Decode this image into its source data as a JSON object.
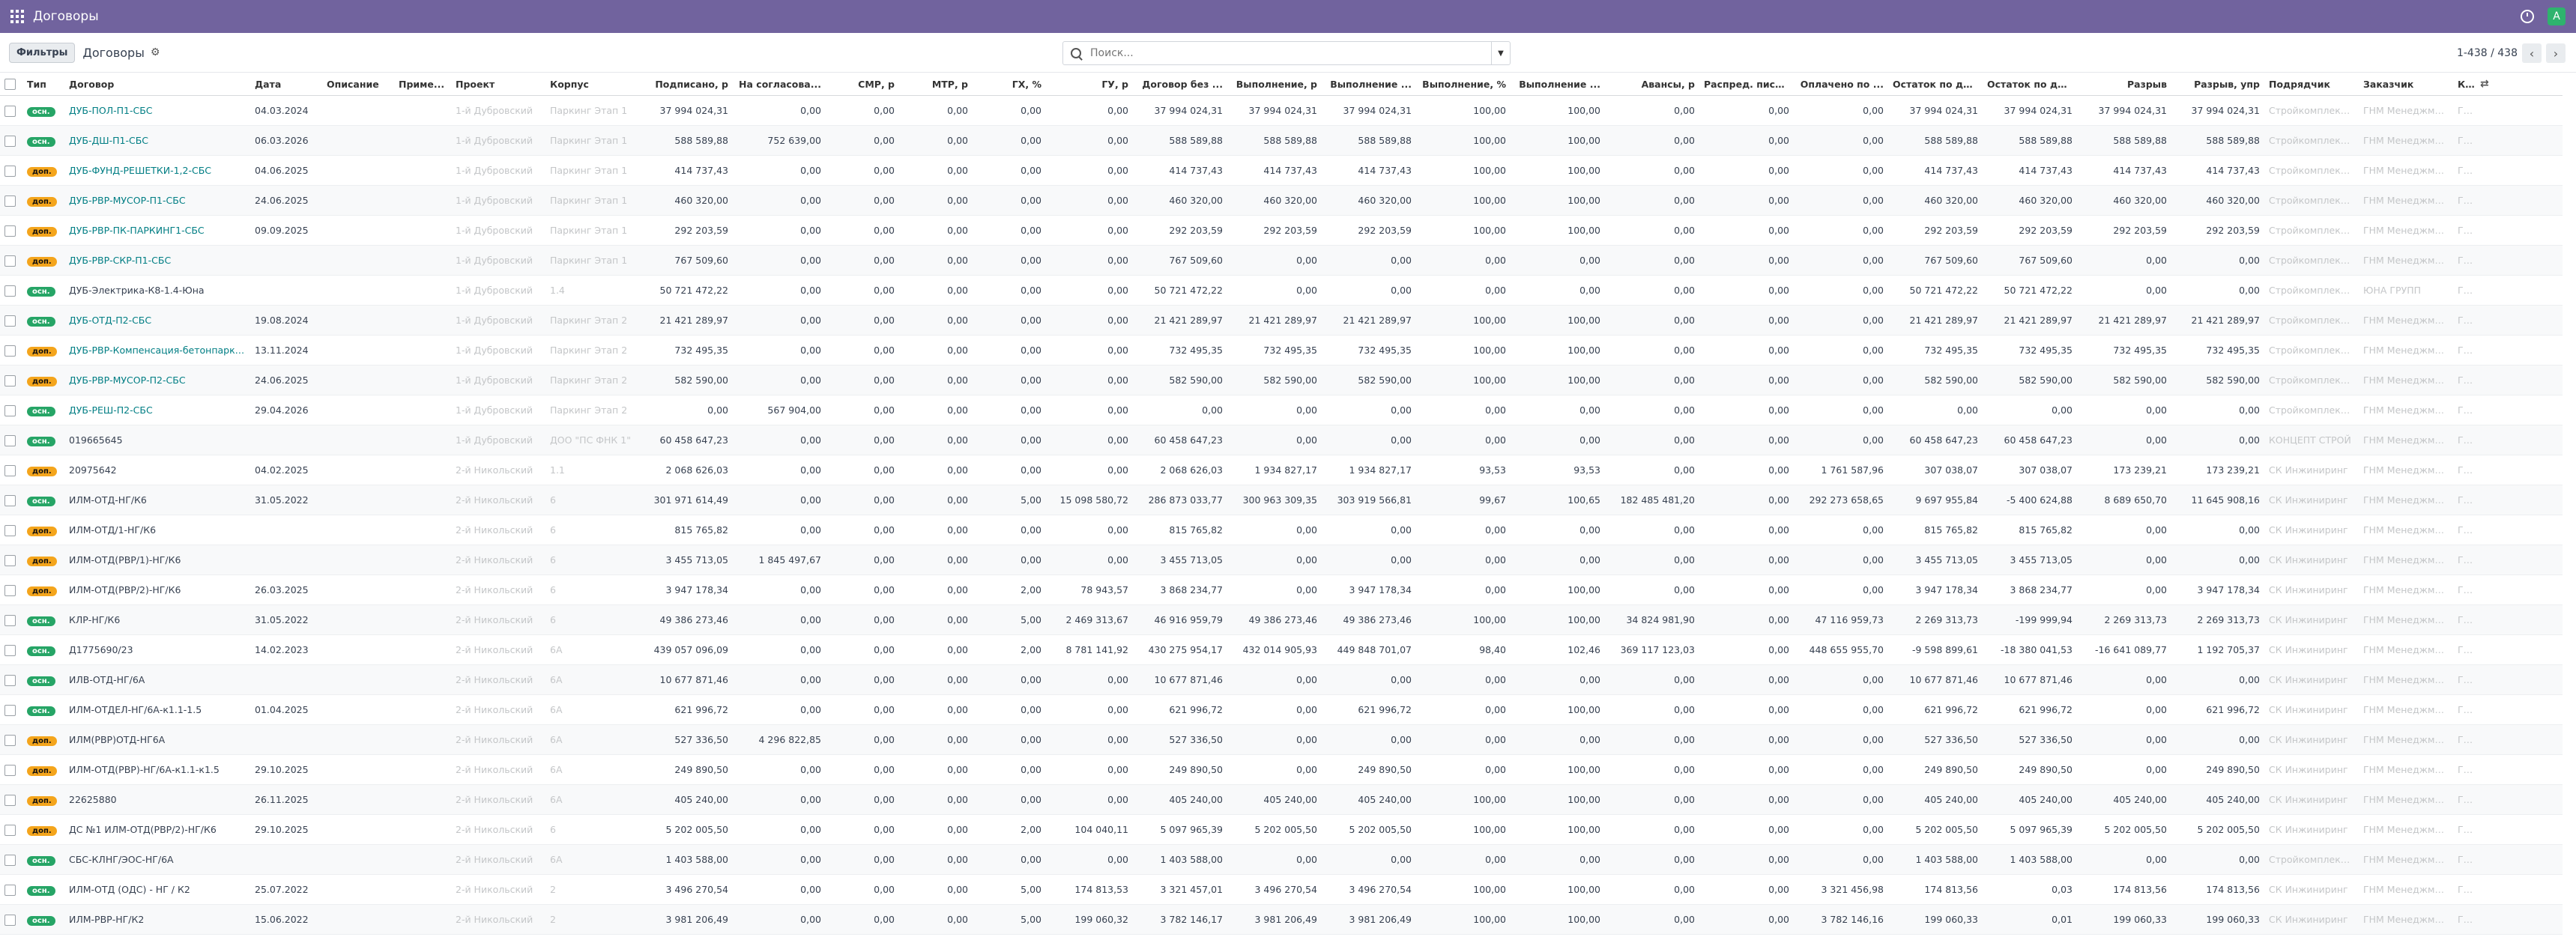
{
  "app": {
    "title": "Договоры",
    "avatar_letter": "A"
  },
  "control": {
    "filters_label": "Фильтры",
    "breadcrumb": "Договоры",
    "search_placeholder": "Поиск...",
    "pager_text": "1-438 / 438",
    "prev": "‹",
    "next": "›"
  },
  "columns": [
    "Тип",
    "Договор",
    "Дата",
    "Описание",
    "Приме...",
    "Проект",
    "Корпус",
    "Подписано, р",
    "На согласова...",
    "СМР, р",
    "МТР, р",
    "ГХ, %",
    "ГУ, р",
    "Договор без ...",
    "Выполнение, р",
    "Выполнение ...",
    "Выполнение, %",
    "Выполнение ...",
    "Авансы, р",
    "Распред. пись...",
    "Оплачено по ...",
    "Остаток по до...",
    "Остаток по до...",
    "Разрыв",
    "Разрыв, упр",
    "Подрядчик",
    "Заказчик",
    "Контрагент"
  ],
  "colors": {
    "accent": "#71639e",
    "badge_main": "#26a566",
    "badge_extra": "#f4a51c",
    "link": "#017e84"
  },
  "rows": [
    {
      "t": "осн.",
      "c": "ДУБ-ПОЛ-П1-СБС",
      "d": "04.03.2024",
      "p": "1-й Дубровский",
      "k": "Паркинг Этап 1",
      "v": [
        "37 994 024,31",
        "0,00",
        "0,00",
        "0,00",
        "0,00",
        "0,00",
        "37 994 024,31",
        "37 994 024,31",
        "37 994 024,31",
        "100,00",
        "100,00",
        "0,00",
        "0,00",
        "0,00",
        "37 994 024,31",
        "37 994 024,31",
        "37 994 024,31",
        "37 994 024,31"
      ],
      "a": "Стройкомплекс Со...",
      "z": "ГНМ Менеджмент",
      "ct": "ГНМ СЗ"
    },
    {
      "t": "осн.",
      "c": "ДУБ-ДШ-П1-СБС",
      "d": "06.03.2026",
      "p": "1-й Дубровский",
      "k": "Паркинг Этап 1",
      "v": [
        "588 589,88",
        "752 639,00",
        "0,00",
        "0,00",
        "0,00",
        "0,00",
        "588 589,88",
        "588 589,88",
        "588 589,88",
        "100,00",
        "100,00",
        "0,00",
        "0,00",
        "0,00",
        "588 589,88",
        "588 589,88",
        "588 589,88",
        "588 589,88"
      ],
      "a": "Стройкомплекс Со...",
      "z": "ГНМ Менеджмент",
      "ct": "ГНМ СЗ"
    },
    {
      "t": "доп.",
      "c": "ДУБ-ФУНД-РЕШЕТКИ-1,2-СБС",
      "d": "04.06.2025",
      "p": "1-й Дубровский",
      "k": "Паркинг Этап 1",
      "v": [
        "414 737,43",
        "0,00",
        "0,00",
        "0,00",
        "0,00",
        "0,00",
        "414 737,43",
        "414 737,43",
        "414 737,43",
        "100,00",
        "100,00",
        "0,00",
        "0,00",
        "0,00",
        "414 737,43",
        "414 737,43",
        "414 737,43",
        "414 737,43"
      ],
      "a": "Стройкомплекс Со...",
      "z": "ГНМ Менеджмент",
      "ct": "ГНМ СЗ"
    },
    {
      "t": "доп.",
      "c": "ДУБ-РВР-МУСОР-П1-СБС",
      "d": "24.06.2025",
      "p": "1-й Дубровский",
      "k": "Паркинг Этап 1",
      "v": [
        "460 320,00",
        "0,00",
        "0,00",
        "0,00",
        "0,00",
        "0,00",
        "460 320,00",
        "460 320,00",
        "460 320,00",
        "100,00",
        "100,00",
        "0,00",
        "0,00",
        "0,00",
        "460 320,00",
        "460 320,00",
        "460 320,00",
        "460 320,00"
      ],
      "a": "Стройкомплекс Со...",
      "z": "ГНМ Менеджмент",
      "ct": "ГНМ СЗ"
    },
    {
      "t": "доп.",
      "c": "ДУБ-РВР-ПК-ПАРКИНГ1-СБС",
      "d": "09.09.2025",
      "p": "1-й Дубровский",
      "k": "Паркинг Этап 1",
      "v": [
        "292 203,59",
        "0,00",
        "0,00",
        "0,00",
        "0,00",
        "0,00",
        "292 203,59",
        "292 203,59",
        "292 203,59",
        "100,00",
        "100,00",
        "0,00",
        "0,00",
        "0,00",
        "292 203,59",
        "292 203,59",
        "292 203,59",
        "292 203,59"
      ],
      "a": "Стройкомплекс Со...",
      "z": "ГНМ Менеджмент",
      "ct": "ГНМ СЗ"
    },
    {
      "t": "доп.",
      "c": "ДУБ-РВР-СКР-П1-СБС",
      "d": "",
      "p": "1-й Дубровский",
      "k": "Паркинг Этап 1",
      "v": [
        "767 509,60",
        "0,00",
        "0,00",
        "0,00",
        "0,00",
        "0,00",
        "767 509,60",
        "0,00",
        "0,00",
        "0,00",
        "0,00",
        "0,00",
        "0,00",
        "0,00",
        "767 509,60",
        "767 509,60",
        "0,00",
        "0,00"
      ],
      "a": "Стройкомплекс Со...",
      "z": "ГНМ Менеджмент",
      "ct": "ГНМ СЗ"
    },
    {
      "t": "осн.",
      "c": "ДУБ-Электрика-К8-1.4-Юна",
      "d": "",
      "p": "1-й Дубровский",
      "k": "1.4",
      "v": [
        "50 721 472,22",
        "0,00",
        "0,00",
        "0,00",
        "0,00",
        "0,00",
        "50 721 472,22",
        "0,00",
        "0,00",
        "0,00",
        "0,00",
        "0,00",
        "0,00",
        "0,00",
        "50 721 472,22",
        "50 721 472,22",
        "0,00",
        "0,00"
      ],
      "a": "Стройкомплекс Со...",
      "z": "ЮНА ГРУПП",
      "ct": "ГНМ СЗ"
    },
    {
      "t": "осн.",
      "c": "ДУБ-ОТД-П2-СБС",
      "d": "19.08.2024",
      "p": "1-й Дубровский",
      "k": "Паркинг Этап 2",
      "v": [
        "21 421 289,97",
        "0,00",
        "0,00",
        "0,00",
        "0,00",
        "0,00",
        "21 421 289,97",
        "21 421 289,97",
        "21 421 289,97",
        "100,00",
        "100,00",
        "0,00",
        "0,00",
        "0,00",
        "21 421 289,97",
        "21 421 289,97",
        "21 421 289,97",
        "21 421 289,97"
      ],
      "a": "Стройкомплекс Со...",
      "z": "ГНМ Менеджмент",
      "ct": "ГНМ СЗ"
    },
    {
      "t": "доп.",
      "c": "ДУБ-РВР-Компенсация-бетонпаркинг",
      "d": "13.11.2024",
      "p": "1-й Дубровский",
      "k": "Паркинг Этап 2",
      "v": [
        "732 495,35",
        "0,00",
        "0,00",
        "0,00",
        "0,00",
        "0,00",
        "732 495,35",
        "732 495,35",
        "732 495,35",
        "100,00",
        "100,00",
        "0,00",
        "0,00",
        "0,00",
        "732 495,35",
        "732 495,35",
        "732 495,35",
        "732 495,35"
      ],
      "a": "Стройкомплекс Со...",
      "z": "ГНМ Менеджмент",
      "ct": "ГНМ СЗ"
    },
    {
      "t": "доп.",
      "c": "ДУБ-РВР-МУСОР-П2-СБС",
      "d": "24.06.2025",
      "p": "1-й Дубровский",
      "k": "Паркинг Этап 2",
      "v": [
        "582 590,00",
        "0,00",
        "0,00",
        "0,00",
        "0,00",
        "0,00",
        "582 590,00",
        "582 590,00",
        "582 590,00",
        "100,00",
        "100,00",
        "0,00",
        "0,00",
        "0,00",
        "582 590,00",
        "582 590,00",
        "582 590,00",
        "582 590,00"
      ],
      "a": "Стройкомплекс Со...",
      "z": "ГНМ Менеджмент",
      "ct": "ГНМ СЗ"
    },
    {
      "t": "осн.",
      "c": "ДУБ-РЕШ-П2-СБС",
      "d": "29.04.2026",
      "p": "1-й Дубровский",
      "k": "Паркинг Этап 2",
      "v": [
        "0,00",
        "567 904,00",
        "0,00",
        "0,00",
        "0,00",
        "0,00",
        "0,00",
        "0,00",
        "0,00",
        "0,00",
        "0,00",
        "0,00",
        "0,00",
        "0,00",
        "0,00",
        "0,00",
        "0,00",
        "0,00"
      ],
      "a": "Стройкомплекс Со...",
      "z": "ГНМ Менеджмент",
      "ct": "ГНМ СЗ"
    },
    {
      "t": "осн.",
      "c": "019665645",
      "d": "",
      "p": "1-й Дубровский",
      "k": "ДОО \"ПС ФНК 1\"",
      "v": [
        "60 458 647,23",
        "0,00",
        "0,00",
        "0,00",
        "0,00",
        "0,00",
        "60 458 647,23",
        "0,00",
        "0,00",
        "0,00",
        "0,00",
        "0,00",
        "0,00",
        "0,00",
        "60 458 647,23",
        "60 458 647,23",
        "0,00",
        "0,00"
      ],
      "a": "КОНЦЕПТ СТРОЙ",
      "z": "ГНМ Менеджмент",
      "ct": "ГНМ СЗ"
    },
    {
      "t": "доп.",
      "c": "20975642",
      "d": "04.02.2025",
      "p": "2-й Никольский",
      "k": "1.1",
      "v": [
        "2 068 626,03",
        "0,00",
        "0,00",
        "0,00",
        "0,00",
        "0,00",
        "2 068 626,03",
        "1 934 827,17",
        "1 934 827,17",
        "93,53",
        "93,53",
        "0,00",
        "0,00",
        "1 761 587,96",
        "307 038,07",
        "307 038,07",
        "173 239,21",
        "173 239,21"
      ],
      "a": "СК Инжиниринг",
      "z": "ГНМ Менеджмент",
      "ct": "ГНМ СЗ"
    },
    {
      "t": "осн.",
      "c": "ИЛМ-ОТД-НГ/К6",
      "d": "31.05.2022",
      "p": "2-й Никольский",
      "k": "6",
      "v": [
        "301 971 614,49",
        "0,00",
        "0,00",
        "0,00",
        "5,00",
        "15 098 580,72",
        "286 873 033,77",
        "300 963 309,35",
        "303 919 566,81",
        "99,67",
        "100,65",
        "182 485 481,20",
        "0,00",
        "292 273 658,65",
        "9 697 955,84",
        "-5 400 624,88",
        "8 689 650,70",
        "11 645 908,16"
      ],
      "a": "СК Инжиниринг",
      "z": "ГНМ Менеджмент",
      "ct": "ГНМ СЗ"
    },
    {
      "t": "доп.",
      "c": "ИЛМ-ОТД/1-НГ/К6",
      "d": "",
      "p": "2-й Никольский",
      "k": "6",
      "v": [
        "815 765,82",
        "0,00",
        "0,00",
        "0,00",
        "0,00",
        "0,00",
        "815 765,82",
        "0,00",
        "0,00",
        "0,00",
        "0,00",
        "0,00",
        "0,00",
        "0,00",
        "815 765,82",
        "815 765,82",
        "0,00",
        "0,00"
      ],
      "a": "СК Инжиниринг",
      "z": "ГНМ Менеджмент",
      "ct": "ГНМ СЗ"
    },
    {
      "t": "доп.",
      "c": "ИЛМ-ОТД(РВР/1)-НГ/К6",
      "d": "",
      "p": "2-й Никольский",
      "k": "6",
      "v": [
        "3 455 713,05",
        "1 845 497,67",
        "0,00",
        "0,00",
        "0,00",
        "0,00",
        "3 455 713,05",
        "0,00",
        "0,00",
        "0,00",
        "0,00",
        "0,00",
        "0,00",
        "0,00",
        "3 455 713,05",
        "3 455 713,05",
        "0,00",
        "0,00"
      ],
      "a": "СК Инжиниринг",
      "z": "ГНМ Менеджмент",
      "ct": "ГНМ СЗ"
    },
    {
      "t": "доп.",
      "c": "ИЛМ-ОТД(РВР/2)-НГ/К6",
      "d": "26.03.2025",
      "p": "2-й Никольский",
      "k": "6",
      "v": [
        "3 947 178,34",
        "0,00",
        "0,00",
        "0,00",
        "2,00",
        "78 943,57",
        "3 868 234,77",
        "0,00",
        "3 947 178,34",
        "0,00",
        "100,00",
        "0,00",
        "0,00",
        "0,00",
        "3 947 178,34",
        "3 868 234,77",
        "0,00",
        "3 947 178,34"
      ],
      "a": "СК Инжиниринг",
      "z": "ГНМ Менеджмент",
      "ct": "ГНМ СЗ"
    },
    {
      "t": "осн.",
      "c": "КЛР-НГ/К6",
      "d": "31.05.2022",
      "p": "2-й Никольский",
      "k": "6",
      "v": [
        "49 386 273,46",
        "0,00",
        "0,00",
        "0,00",
        "5,00",
        "2 469 313,67",
        "46 916 959,79",
        "49 386 273,46",
        "49 386 273,46",
        "100,00",
        "100,00",
        "34 824 981,90",
        "0,00",
        "47 116 959,73",
        "2 269 313,73",
        "-199 999,94",
        "2 269 313,73",
        "2 269 313,73"
      ],
      "a": "СК Инжиниринг",
      "z": "ГНМ Менеджмент",
      "ct": "ГНМ СЗ"
    },
    {
      "t": "осн.",
      "c": "Д1775690/23",
      "d": "14.02.2023",
      "p": "2-й Никольский",
      "k": "6А",
      "v": [
        "439 057 096,09",
        "0,00",
        "0,00",
        "0,00",
        "2,00",
        "8 781 141,92",
        "430 275 954,17",
        "432 014 905,93",
        "449 848 701,07",
        "98,40",
        "102,46",
        "369 117 123,03",
        "0,00",
        "448 655 955,70",
        "-9 598 899,61",
        "-18 380 041,53",
        "-16 641 089,77",
        "1 192 705,37"
      ],
      "a": "СК Инжиниринг",
      "z": "ГНМ Менеджмент",
      "ct": "ГНМ СЗ"
    },
    {
      "t": "осн.",
      "c": "ИЛВ-ОТД-НГ/6А",
      "d": "",
      "p": "2-й Никольский",
      "k": "6А",
      "v": [
        "10 677 871,46",
        "0,00",
        "0,00",
        "0,00",
        "0,00",
        "0,00",
        "10 677 871,46",
        "0,00",
        "0,00",
        "0,00",
        "0,00",
        "0,00",
        "0,00",
        "0,00",
        "10 677 871,46",
        "10 677 871,46",
        "0,00",
        "0,00"
      ],
      "a": "СК Инжиниринг",
      "z": "ГНМ Менеджмент",
      "ct": "ГНМ СЗ"
    },
    {
      "t": "осн.",
      "c": "ИЛМ-ОТДЕЛ-НГ/6А-к1.1-1.5",
      "d": "01.04.2025",
      "p": "2-й Никольский",
      "k": "6А",
      "v": [
        "621 996,72",
        "0,00",
        "0,00",
        "0,00",
        "0,00",
        "0,00",
        "621 996,72",
        "0,00",
        "621 996,72",
        "0,00",
        "100,00",
        "0,00",
        "0,00",
        "0,00",
        "621 996,72",
        "621 996,72",
        "0,00",
        "621 996,72"
      ],
      "a": "СК Инжиниринг",
      "z": "ГНМ Менеджмент",
      "ct": "ГНМ СЗ"
    },
    {
      "t": "доп.",
      "c": "ИЛМ(РВР)ОТД-НГ6А",
      "d": "",
      "p": "2-й Никольский",
      "k": "6А",
      "v": [
        "527 336,50",
        "4 296 822,85",
        "0,00",
        "0,00",
        "0,00",
        "0,00",
        "527 336,50",
        "0,00",
        "0,00",
        "0,00",
        "0,00",
        "0,00",
        "0,00",
        "0,00",
        "527 336,50",
        "527 336,50",
        "0,00",
        "0,00"
      ],
      "a": "СК Инжиниринг",
      "z": "ГНМ Менеджмент",
      "ct": "ГНМ СЗ"
    },
    {
      "t": "доп.",
      "c": "ИЛМ-ОТД(РВР)-НГ/6А-к1.1-к1.5",
      "d": "29.10.2025",
      "p": "2-й Никольский",
      "k": "6А",
      "v": [
        "249 890,50",
        "0,00",
        "0,00",
        "0,00",
        "0,00",
        "0,00",
        "249 890,50",
        "0,00",
        "249 890,50",
        "0,00",
        "100,00",
        "0,00",
        "0,00",
        "0,00",
        "249 890,50",
        "249 890,50",
        "0,00",
        "249 890,50"
      ],
      "a": "СК Инжиниринг",
      "z": "ГНМ Менеджмент",
      "ct": "ГНМ СЗ"
    },
    {
      "t": "доп.",
      "c": "22625880",
      "d": "26.11.2025",
      "p": "2-й Никольский",
      "k": "6А",
      "v": [
        "405 240,00",
        "0,00",
        "0,00",
        "0,00",
        "0,00",
        "0,00",
        "405 240,00",
        "405 240,00",
        "405 240,00",
        "100,00",
        "100,00",
        "0,00",
        "0,00",
        "0,00",
        "405 240,00",
        "405 240,00",
        "405 240,00",
        "405 240,00"
      ],
      "a": "СК Инжиниринг",
      "z": "ГНМ Менеджмент",
      "ct": "ГНМ СЗ"
    },
    {
      "t": "доп.",
      "c": "ДС №1 ИЛМ-ОТД(РВР/2)-НГ/К6",
      "d": "29.10.2025",
      "p": "2-й Никольский",
      "k": "6",
      "v": [
        "5 202 005,50",
        "0,00",
        "0,00",
        "0,00",
        "2,00",
        "104 040,11",
        "5 097 965,39",
        "5 202 005,50",
        "5 202 005,50",
        "100,00",
        "100,00",
        "0,00",
        "0,00",
        "0,00",
        "5 202 005,50",
        "5 097 965,39",
        "5 202 005,50",
        "5 202 005,50"
      ],
      "a": "СК Инжиниринг",
      "z": "ГНМ Менеджмент",
      "ct": "ГНМ СЗ"
    },
    {
      "t": "осн.",
      "c": "СБС-КЛНГ/ЭОС-НГ/6А",
      "d": "",
      "p": "2-й Никольский",
      "k": "6А",
      "v": [
        "1 403 588,00",
        "0,00",
        "0,00",
        "0,00",
        "0,00",
        "0,00",
        "1 403 588,00",
        "0,00",
        "0,00",
        "0,00",
        "0,00",
        "0,00",
        "0,00",
        "0,00",
        "1 403 588,00",
        "1 403 588,00",
        "0,00",
        "0,00"
      ],
      "a": "Стройкомплекс Со...",
      "z": "ГНМ Менеджмент",
      "ct": "ГНМ СЗ"
    },
    {
      "t": "осн.",
      "c": "ИЛМ-ОТД (ОДС) - НГ / К2",
      "d": "25.07.2022",
      "p": "2-й Никольский",
      "k": "2",
      "v": [
        "3 496 270,54",
        "0,00",
        "0,00",
        "0,00",
        "5,00",
        "174 813,53",
        "3 321 457,01",
        "3 496 270,54",
        "3 496 270,54",
        "100,00",
        "100,00",
        "0,00",
        "0,00",
        "3 321 456,98",
        "174 813,56",
        "0,03",
        "174 813,56",
        "174 813,56"
      ],
      "a": "СК Инжиниринг",
      "z": "ГНМ Менеджмент",
      "ct": "ГНМ СЗ"
    },
    {
      "t": "осн.",
      "c": "ИЛМ-РВР-НГ/К2",
      "d": "15.06.2022",
      "p": "2-й Никольский",
      "k": "2",
      "v": [
        "3 981 206,49",
        "0,00",
        "0,00",
        "0,00",
        "5,00",
        "199 060,32",
        "3 782 146,17",
        "3 981 206,49",
        "3 981 206,49",
        "100,00",
        "100,00",
        "0,00",
        "0,00",
        "3 782 146,16",
        "199 060,33",
        "0,01",
        "199 060,33",
        "199 060,33"
      ],
      "a": "СК Инжиниринг",
      "z": "ГНМ Менеджмент",
      "ct": "ГНМ СЗ"
    }
  ]
}
